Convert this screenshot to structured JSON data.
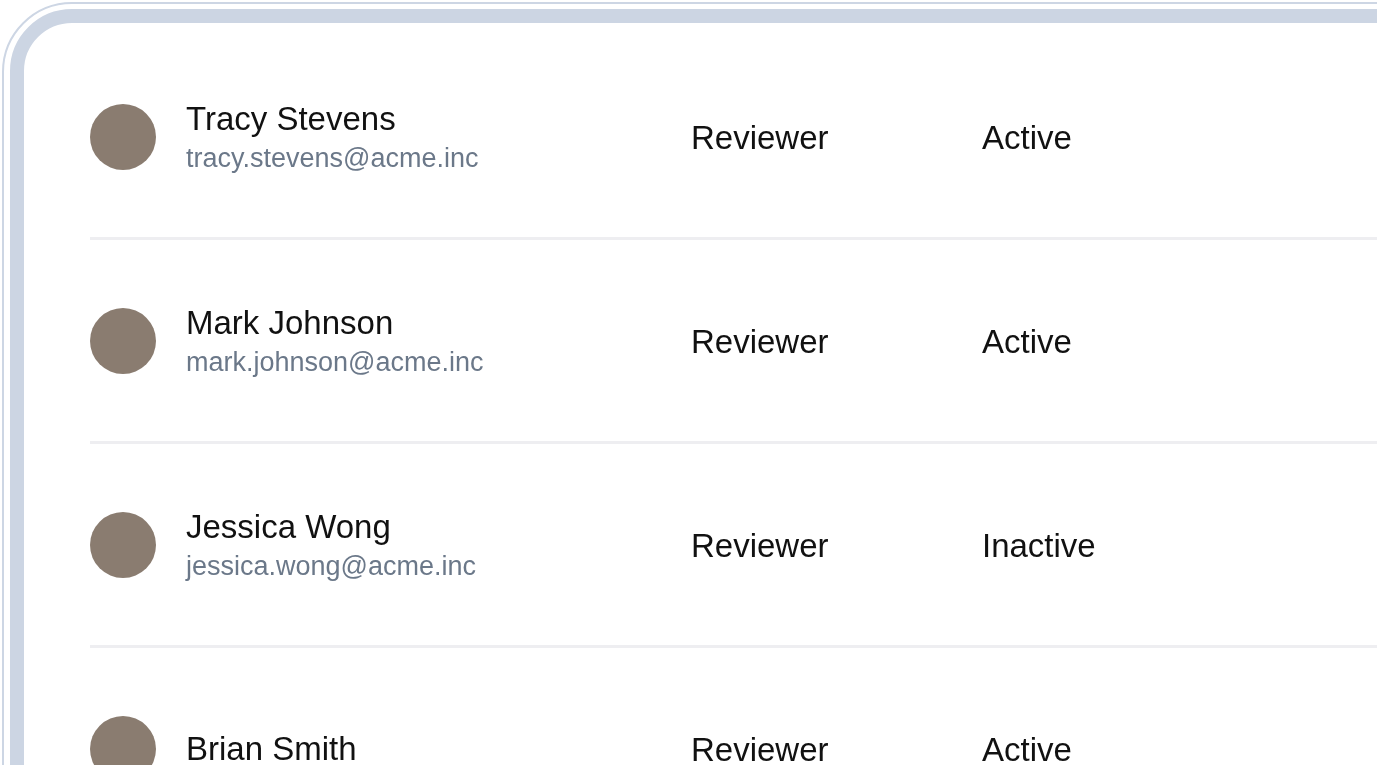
{
  "users": [
    {
      "name": "Tracy Stevens",
      "email": "tracy.stevens@acme.inc",
      "role": "Reviewer",
      "status": "Active"
    },
    {
      "name": "Mark Johnson",
      "email": "mark.johnson@acme.inc",
      "role": "Reviewer",
      "status": "Active"
    },
    {
      "name": "Jessica Wong",
      "email": "jessica.wong@acme.inc",
      "role": "Reviewer",
      "status": "Inactive"
    },
    {
      "name": "Brian Smith",
      "role": "Reviewer",
      "status": "Active"
    }
  ]
}
